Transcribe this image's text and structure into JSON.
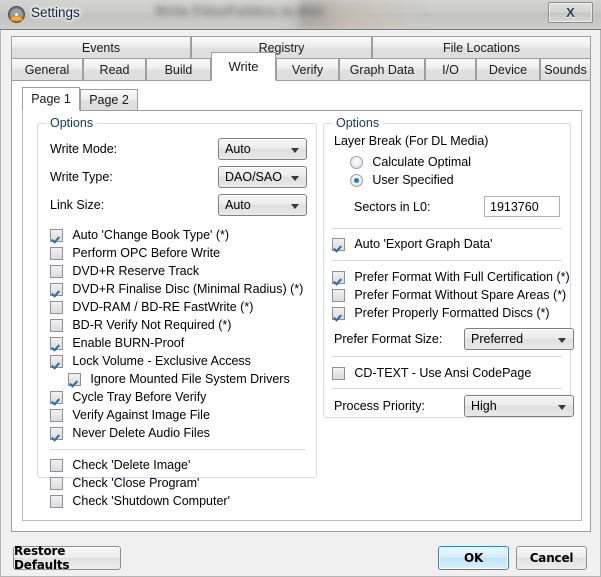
{
  "window": {
    "title": "Settings",
    "icon": "disc-burn-icon",
    "close_label": "X",
    "ghost_background_title": "Write Files/Folders to disc"
  },
  "tabs_top": [
    {
      "label": "Events"
    },
    {
      "label": "Registry"
    },
    {
      "label": "File Locations"
    }
  ],
  "tabs_bottom": [
    {
      "label": "General",
      "selected": false
    },
    {
      "label": "Read",
      "selected": false
    },
    {
      "label": "Build",
      "selected": false
    },
    {
      "label": "Write",
      "selected": true
    },
    {
      "label": "Verify",
      "selected": false
    },
    {
      "label": "Graph Data",
      "selected": false
    },
    {
      "label": "I/O",
      "selected": false
    },
    {
      "label": "Device",
      "selected": false
    },
    {
      "label": "Sounds",
      "selected": false
    }
  ],
  "inner_tabs": [
    {
      "label": "Page 1",
      "selected": true
    },
    {
      "label": "Page 2",
      "selected": false
    }
  ],
  "left_panel": {
    "legend": "Options",
    "fields": [
      {
        "label": "Write Mode:",
        "value": "Auto"
      },
      {
        "label": "Write Type:",
        "value": "DAO/SAO"
      },
      {
        "label": "Link Size:",
        "value": "Auto"
      }
    ],
    "checkboxes_main": [
      {
        "label": "Auto 'Change Book Type' (*)",
        "checked": true,
        "indent": false
      },
      {
        "label": "Perform OPC Before Write",
        "checked": false,
        "indent": false
      },
      {
        "label": "DVD+R Reserve Track",
        "checked": false,
        "indent": false
      },
      {
        "label": "DVD+R Finalise Disc (Minimal Radius) (*)",
        "checked": true,
        "indent": false
      },
      {
        "label": "DVD-RAM / BD-RE FastWrite (*)",
        "checked": false,
        "indent": false
      },
      {
        "label": "BD-R Verify Not Required (*)",
        "checked": false,
        "indent": false
      },
      {
        "label": "Enable BURN-Proof",
        "checked": true,
        "indent": false
      },
      {
        "label": "Lock Volume - Exclusive Access",
        "checked": true,
        "indent": false
      },
      {
        "label": "Ignore Mounted File System Drivers",
        "checked": true,
        "indent": true
      },
      {
        "label": "Cycle Tray Before Verify",
        "checked": true,
        "indent": false
      },
      {
        "label": "Verify Against Image File",
        "checked": false,
        "indent": false
      },
      {
        "label": "Never Delete Audio Files",
        "checked": true,
        "indent": false
      }
    ],
    "checkboxes_secondary": [
      {
        "label": "Check 'Delete Image'",
        "checked": false
      },
      {
        "label": "Check 'Close Program'",
        "checked": false
      },
      {
        "label": "Check 'Shutdown Computer'",
        "checked": false
      }
    ]
  },
  "right_panel": {
    "legend": "Options",
    "layer_break_label": "Layer Break (For DL Media)",
    "radios": [
      {
        "label": "Calculate Optimal",
        "selected": false
      },
      {
        "label": "User Specified",
        "selected": true
      }
    ],
    "sectors_label": "Sectors in L0:",
    "sectors_value": "1913760",
    "auto_export": {
      "label": "Auto 'Export Graph Data'",
      "checked": true
    },
    "prefer_checkboxes": [
      {
        "label": "Prefer Format With Full Certification (*)",
        "checked": true
      },
      {
        "label": "Prefer Format Without Spare Areas (*)",
        "checked": false
      },
      {
        "label": "Prefer Properly Formatted Discs (*)",
        "checked": true
      }
    ],
    "format_size": {
      "label": "Prefer Format Size:",
      "value": "Preferred"
    },
    "cdtext": {
      "label": "CD-TEXT - Use Ansi CodePage",
      "checked": false
    },
    "priority": {
      "label": "Process Priority:",
      "value": "High"
    }
  },
  "footer": {
    "restore_defaults": "Restore Defaults",
    "ok": "OK",
    "cancel": "Cancel"
  },
  "colors": {
    "legend_text": "#17375e",
    "accent_default_button": "#2e87c7",
    "checkmark": "#2c6ba8",
    "radio_dot": "#2879c4"
  }
}
